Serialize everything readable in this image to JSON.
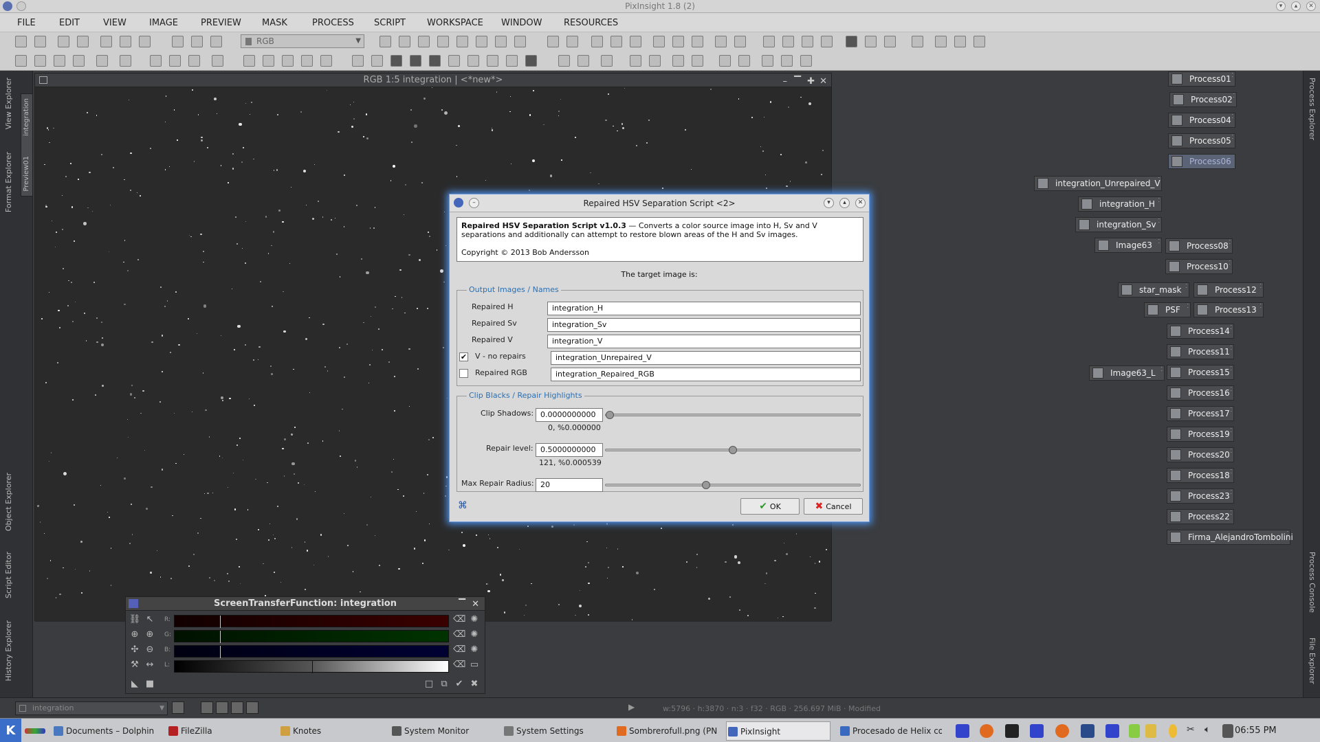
{
  "app": {
    "window_title": "PixInsight 1.8 (2)"
  },
  "menu": [
    "FILE",
    "EDIT",
    "VIEW",
    "IMAGE",
    "PREVIEW",
    "MASK",
    "PROCESS",
    "SCRIPT",
    "WORKSPACE",
    "WINDOW",
    "RESOURCES"
  ],
  "toolbar": {
    "color_space": "RGB"
  },
  "left_dock_tabs": [
    "View Explorer",
    "Format Explorer",
    "Object Explorer",
    "Script Editor",
    "History Explorer"
  ],
  "right_dock_tabs": [
    "Process Explorer",
    "Process Console",
    "File Explorer"
  ],
  "image_window": {
    "title": "RGB 1:5 integration | <*new*>",
    "vtab_integration": "integration",
    "vtab_preview": "Preview01"
  },
  "process_icons": [
    {
      "label": "Process01"
    },
    {
      "label": "Process02"
    },
    {
      "label": "Process04"
    },
    {
      "label": "Process05"
    },
    {
      "label": "Process06"
    },
    {
      "label": "integration_Unrepaired_V"
    },
    {
      "label": "integration_H"
    },
    {
      "label": "integration_Sv"
    },
    {
      "label": "Image63"
    },
    {
      "label": "Process08"
    },
    {
      "label": "Process10"
    },
    {
      "label": "star_mask"
    },
    {
      "label": "Process12"
    },
    {
      "label": "PSF"
    },
    {
      "label": "Process13"
    },
    {
      "label": "Process14"
    },
    {
      "label": "Process11"
    },
    {
      "label": "Image63_L"
    },
    {
      "label": "Process15"
    },
    {
      "label": "Process16"
    },
    {
      "label": "Process17"
    },
    {
      "label": "Process19"
    },
    {
      "label": "Process20"
    },
    {
      "label": "Process18"
    },
    {
      "label": "Process23"
    },
    {
      "label": "Process22"
    },
    {
      "label": "Firma_AlejandroTombolini"
    }
  ],
  "dialog": {
    "title": "Repaired HSV Separation Script <2>",
    "desc_title": "Repaired HSV Separation Script v1.0.3",
    "desc_body": " — Converts a color source image into H, Sv and V separations and additionally can attempt to restore blown areas of the H and Sv images.",
    "copyright": "Copyright © 2013 Bob Andersson",
    "target": "The target image is:",
    "output_group": "Output Images / Names",
    "repaired_h_label": "Repaired H",
    "repaired_h": "integration_H",
    "repaired_sv_label": "Repaired Sv",
    "repaired_sv": "integration_Sv",
    "repaired_v_label": "Repaired V",
    "repaired_v": "integration_V",
    "v_norepairs_label": "V - no repairs",
    "v_norepairs": "integration_Unrepaired_V",
    "v_norepairs_checked": true,
    "repaired_rgb_label": "Repaired RGB",
    "repaired_rgb": "integration_Repaired_RGB",
    "repaired_rgb_checked": false,
    "clip_group": "Clip Blacks / Repair Highlights",
    "clip_shadows_label": "Clip Shadows:",
    "clip_shadows": "0.0000000000",
    "clip_shadows_sub": "0, %0.000000",
    "clip_shadows_fraction": 0,
    "repair_level_label": "Repair level:",
    "repair_level": "0.5000000000",
    "repair_level_sub": "121, %0.000539",
    "repair_level_fraction": 0.5,
    "max_radius_label": "Max Repair Radius:",
    "max_radius": "20",
    "max_radius_fraction": 0.39,
    "ok": "OK",
    "cancel": "Cancel"
  },
  "stf": {
    "title": "ScreenTransferFunction: integration",
    "channels": [
      "R:",
      "G:",
      "B:",
      "L:"
    ]
  },
  "statusbar": {
    "view": "integration",
    "info": "w:5796  ·  h:3870  ·  n:3  ·  f32  ·  RGB  ·  256.697 MiB  ·  Modified"
  },
  "taskbar": {
    "items": [
      "Documents – Dolphin",
      "FileZilla",
      "Knotes",
      "System Monitor",
      "System Settings",
      "Sombrerofull.png (PN",
      "PixInsight",
      "Procesado de Helix co"
    ],
    "clock": "06:55 PM"
  }
}
